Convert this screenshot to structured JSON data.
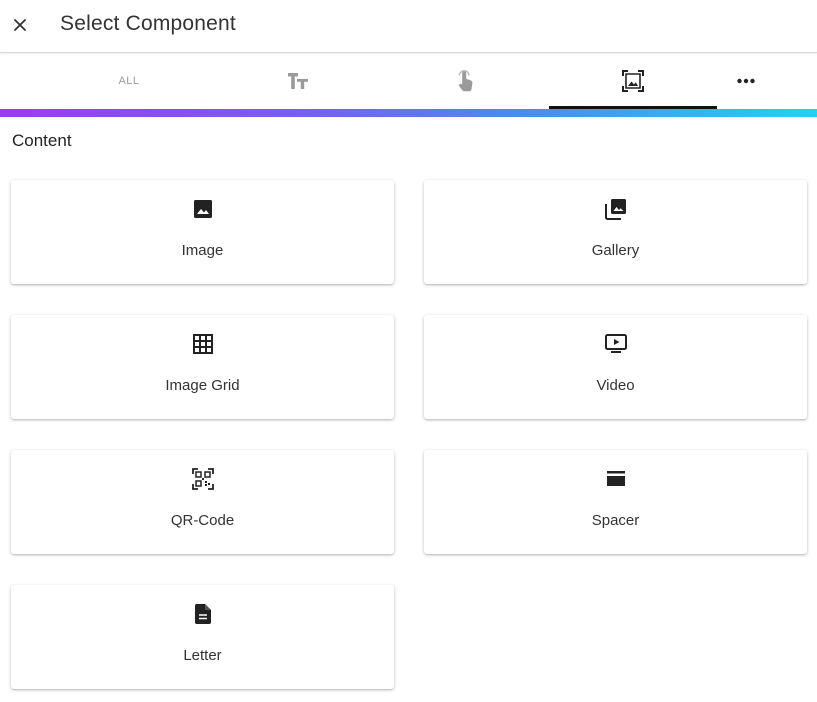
{
  "header": {
    "title": "Select Component",
    "close_icon": "close-icon"
  },
  "tabs": [
    {
      "label": "ALL",
      "icon": null,
      "active": false
    },
    {
      "label": "",
      "icon": "text-format-icon",
      "active": false
    },
    {
      "label": "",
      "icon": "touch-icon",
      "active": false
    },
    {
      "label": "",
      "icon": "image-frame-icon",
      "active": true
    },
    {
      "label": "",
      "icon": "more-horizontal-icon",
      "active": false
    }
  ],
  "colors": {
    "gradient_start": "#9a3cf0",
    "gradient_end": "#22d2f2",
    "tab_indicator": "#111111"
  },
  "section": {
    "title": "Content"
  },
  "components": [
    {
      "label": "Image",
      "icon": "image-icon"
    },
    {
      "label": "Gallery",
      "icon": "gallery-icon"
    },
    {
      "label": "Image Grid",
      "icon": "grid-icon"
    },
    {
      "label": "Video",
      "icon": "video-icon"
    },
    {
      "label": "QR-Code",
      "icon": "qr-code-icon"
    },
    {
      "label": "Spacer",
      "icon": "spacer-icon"
    },
    {
      "label": "Letter",
      "icon": "document-icon"
    }
  ]
}
